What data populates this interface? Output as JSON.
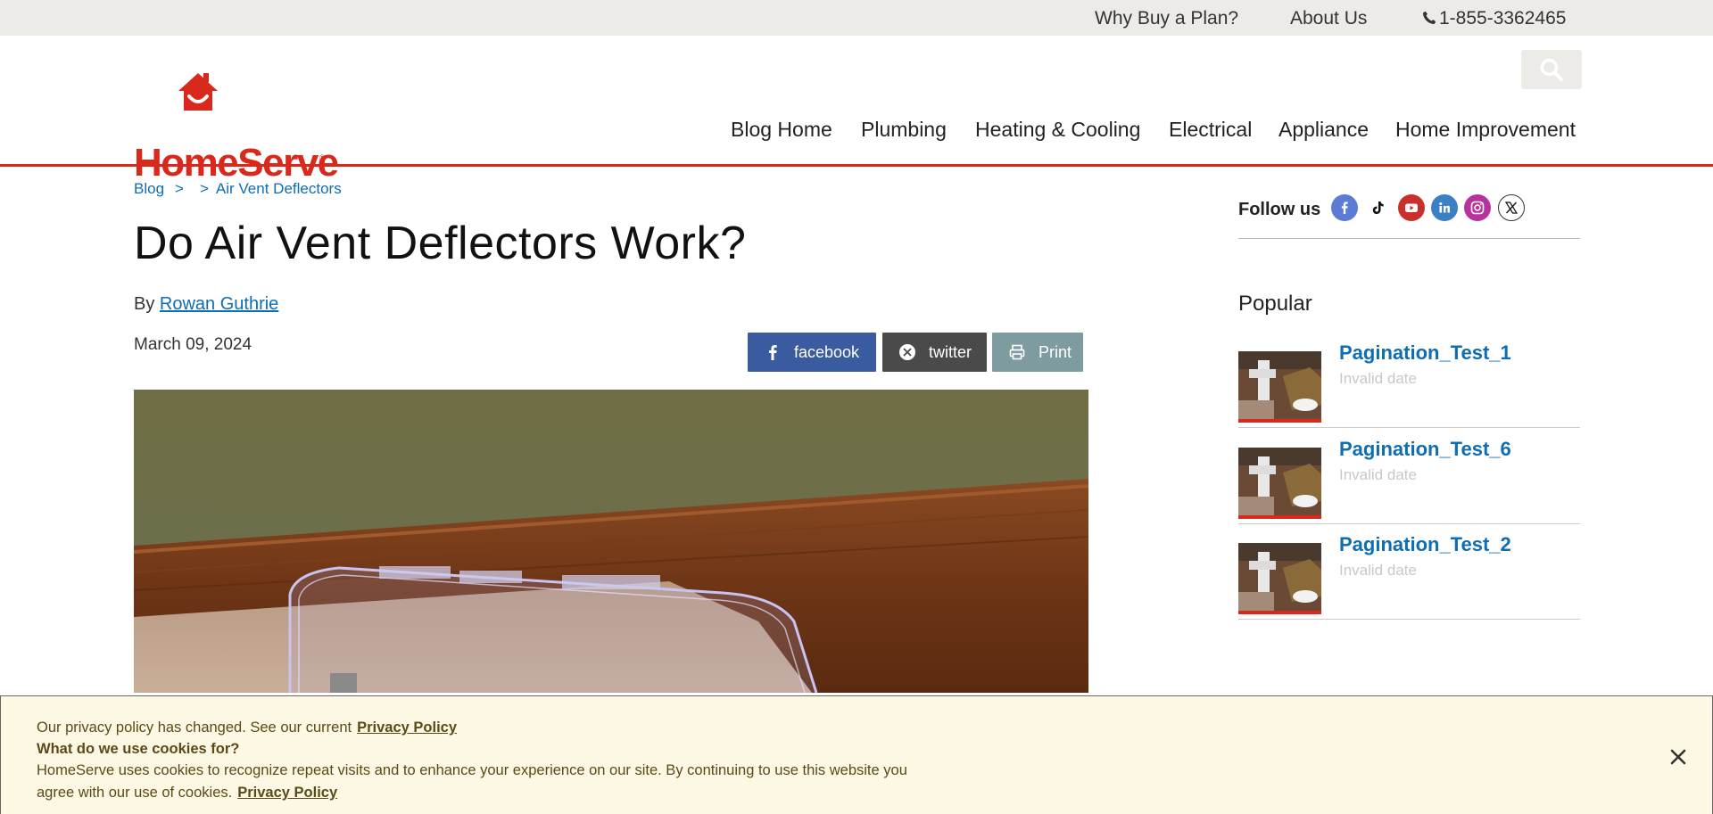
{
  "topbar": {
    "why_buy": "Why Buy a Plan?",
    "about": "About Us",
    "phone": "1-855-3362465",
    "phone_icon": "phone-icon"
  },
  "header": {
    "logo_text": "HomeServe",
    "logo_reg": "®",
    "brand_color": "#d9291c",
    "search_icon": "search-icon",
    "nav": [
      "Blog Home",
      "Plumbing",
      "Heating & Cooling",
      "Electrical",
      "Appliance",
      "Home Improvement"
    ]
  },
  "breadcrumb": {
    "blog": "Blog",
    "sep": ">",
    "current": "Air Vent Deflectors"
  },
  "article": {
    "title": "Do Air Vent Deflectors Work?",
    "by": "By",
    "author": "Rowan Guthrie",
    "date": "March 09, 2024",
    "share": {
      "facebook": "facebook",
      "twitter": "twitter",
      "print": "Print"
    }
  },
  "sidebar": {
    "follow_label": "Follow us",
    "social_icons": [
      "facebook-icon",
      "tiktok-icon",
      "youtube-icon",
      "linkedin-icon",
      "instagram-icon",
      "x-icon"
    ],
    "popular_heading": "Popular",
    "popular": [
      {
        "title": "Pagination_Test_1",
        "date": "Invalid date"
      },
      {
        "title": "Pagination_Test_6",
        "date": "Invalid date"
      },
      {
        "title": "Pagination_Test_2",
        "date": "Invalid date"
      }
    ]
  },
  "cookie": {
    "line1": "Our privacy policy has changed. See our current",
    "line1_link": "Privacy Policy",
    "line2": "What do we use cookies for?",
    "line3": "HomeServe uses cookies to recognize repeat visits and to enhance your experience on our site. By continuing to use this website you",
    "line4": "agree with our use of cookies.",
    "line4_link": "Privacy Policy",
    "close_icon": "close-icon"
  }
}
